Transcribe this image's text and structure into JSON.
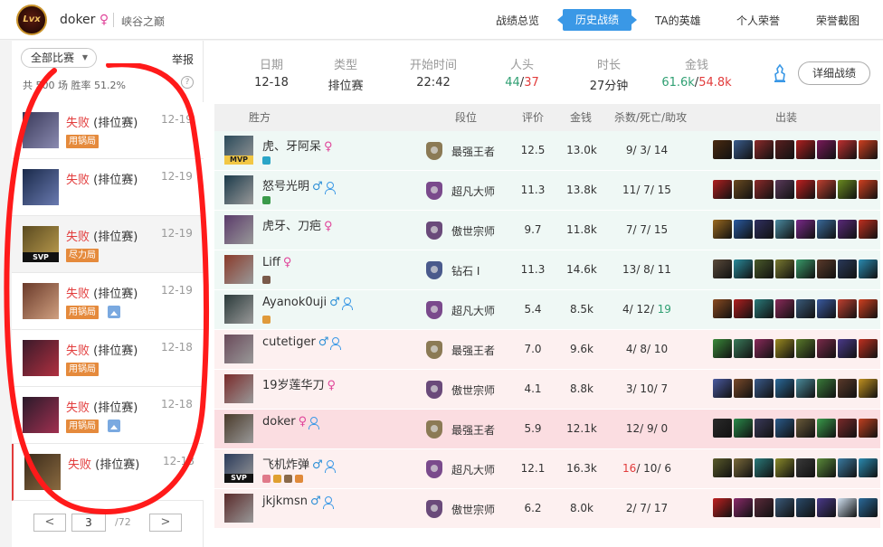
{
  "header": {
    "logo_text": "Lvx",
    "username": "doker",
    "gender_symbol": "♀",
    "server": "峡谷之巅",
    "nav": [
      "战绩总览",
      "历史战绩",
      "TA的英雄",
      "个人荣誉",
      "荣誉截图"
    ],
    "active_nav": "历史战绩"
  },
  "sidebar": {
    "filter_label": "全部比赛",
    "report_label": "举报",
    "stat_text": "共 500 场  胜率 51.2%",
    "help_label": "?",
    "matches": [
      {
        "result": "失败",
        "mode": "(排位赛)",
        "date": "12-19",
        "tag": "用锅局",
        "has_pic": false,
        "badge": ""
      },
      {
        "result": "失败",
        "mode": "(排位赛)",
        "date": "12-19",
        "tag": "",
        "has_pic": false,
        "badge": ""
      },
      {
        "result": "失败",
        "mode": "(排位赛)",
        "date": "12-19",
        "tag": "尽力局",
        "has_pic": false,
        "badge": "SVP"
      },
      {
        "result": "失败",
        "mode": "(排位赛)",
        "date": "12-19",
        "tag": "用锅局",
        "has_pic": true,
        "badge": ""
      },
      {
        "result": "失败",
        "mode": "(排位赛)",
        "date": "12-18",
        "tag": "用锅局",
        "has_pic": false,
        "badge": ""
      },
      {
        "result": "失败",
        "mode": "(排位赛)",
        "date": "12-18",
        "tag": "用锅局",
        "has_pic": true,
        "badge": ""
      },
      {
        "result": "失败",
        "mode": "(排位赛)",
        "date": "12-18",
        "tag": "",
        "has_pic": false,
        "badge": ""
      }
    ],
    "pager": {
      "prev": "<",
      "page": "3",
      "total": "/72",
      "next": ">"
    }
  },
  "summary": {
    "date_label": "日期",
    "date": "12-18",
    "type_label": "类型",
    "type": "排位赛",
    "start_label": "开始时间",
    "start": "22:42",
    "kills_label": "人头",
    "kills_a": "44",
    "kills_sep": "/",
    "kills_b": "37",
    "duration_label": "时长",
    "duration": "27分钟",
    "gold_label": "金钱",
    "gold_a": "61.6k",
    "gold_sep": "/",
    "gold_b": "54.8k",
    "detail_button": "详细战绩"
  },
  "table": {
    "headers": {
      "team": "胜方",
      "rank": "段位",
      "score": "评价",
      "gold": "金钱",
      "kda": "杀数/死亡/助攻",
      "items": "出装"
    },
    "rows": [
      {
        "side": "win",
        "name": "虎、牙阿呆",
        "gender": "♀",
        "friend": false,
        "badge": "MVP",
        "rank": "最强王者",
        "rank_color": "#8b7a55",
        "score": "12.5",
        "score_hl": true,
        "gold": "13.0k",
        "gold_hl": false,
        "k": "9",
        "d": "3",
        "a": "14",
        "k_hl": false,
        "a_hl": false,
        "marks": [
          "#2aa5c7"
        ],
        "items": [
          "#4a2a10",
          "#3a5c8c",
          "#8c2a2a",
          "#5a1f1f",
          "#b02020",
          "#7a1a5a",
          "#c03030",
          "#d04020"
        ]
      },
      {
        "side": "win",
        "name": "怒号光明",
        "gender": "♂",
        "friend": true,
        "badge": "",
        "rank": "超凡大师",
        "rank_color": "#7a4a8c",
        "score": "11.3",
        "score_hl": false,
        "gold": "13.8k",
        "gold_hl": false,
        "k": "11",
        "d": "7",
        "a": "15",
        "k_hl": false,
        "a_hl": false,
        "marks": [
          "#3a9a4a"
        ],
        "items": [
          "#b02020",
          "#6a4a20",
          "#8c2a2a",
          "#5a3a5a",
          "#c02020",
          "#c04030",
          "#6a8a20",
          "#d04020"
        ]
      },
      {
        "side": "win",
        "name": "虎牙、刀疤",
        "gender": "♀",
        "friend": false,
        "badge": "",
        "rank": "傲世宗师",
        "rank_color": "#6a4a7a",
        "score": "9.7",
        "score_hl": false,
        "gold": "11.8k",
        "gold_hl": false,
        "k": "7",
        "d": "7",
        "a": "15",
        "k_hl": false,
        "a_hl": false,
        "marks": [],
        "items": [
          "#9a6a20",
          "#2a5aa0",
          "#303060",
          "#4a8aa0",
          "#7a2a8a",
          "#3a6a9a",
          "#5a2a7a",
          "#c03020"
        ]
      },
      {
        "side": "win",
        "name": "Liff",
        "gender": "♀",
        "friend": false,
        "badge": "",
        "rank": "钻石 Ⅰ",
        "rank_color": "#4a5a8c",
        "score": "11.3",
        "score_hl": false,
        "gold": "14.6k",
        "gold_hl": false,
        "k": "13",
        "d": "8",
        "a": "11",
        "k_hl": false,
        "a_hl": false,
        "marks": [
          "#7a5a4a"
        ],
        "items": [
          "#5a4a3a",
          "#2a8a9a",
          "#4a5a2a",
          "#7a7a30",
          "#3a9a6a",
          "#5a3a2a",
          "#2a3a5a",
          "#2a8ab0"
        ]
      },
      {
        "side": "win",
        "name": "Ayanok0uji",
        "gender": "♂",
        "friend": true,
        "badge": "",
        "rank": "超凡大师",
        "rank_color": "#7a4a8c",
        "score": "5.4",
        "score_hl": false,
        "gold": "8.5k",
        "gold_hl": false,
        "k": "4",
        "d": "12",
        "a": "19",
        "k_hl": false,
        "a_hl": true,
        "marks": [
          "#e09a3a"
        ],
        "items": [
          "#8a4a20",
          "#b02020",
          "#2a7a7a",
          "#8a2a5a",
          "#3a5a7a",
          "#3a5aa0",
          "#c04030",
          "#d04020"
        ]
      },
      {
        "side": "lose",
        "name": "cutetiger",
        "gender": "♂",
        "friend": true,
        "badge": "",
        "rank": "最强王者",
        "rank_color": "#8b7a55",
        "score": "7.0",
        "score_hl": false,
        "gold": "9.6k",
        "gold_hl": false,
        "k": "4",
        "d": "8",
        "a": "10",
        "k_hl": false,
        "a_hl": false,
        "marks": [],
        "items": [
          "#3a8a3a",
          "#3a7a5a",
          "#8a2a5a",
          "#9a8a20",
          "#5a7a2a",
          "#7a2a4a",
          "#4a3a8a",
          "#c03020"
        ]
      },
      {
        "side": "lose",
        "name": "19岁莲华刀",
        "gender": "♀",
        "friend": false,
        "badge": "",
        "rank": "傲世宗师",
        "rank_color": "#6a4a7a",
        "score": "4.1",
        "score_hl": false,
        "gold": "8.8k",
        "gold_hl": false,
        "k": "3",
        "d": "10",
        "a": "7",
        "k_hl": false,
        "a_hl": false,
        "marks": [],
        "items": [
          "#4a5aa0",
          "#7a4a2a",
          "#3a5a8a",
          "#2a6a9a",
          "#4a8a9a",
          "#3a7a3a",
          "#5a3a2a",
          "#c09020"
        ]
      },
      {
        "side": "me",
        "name": "doker",
        "gender": "♀",
        "friend": true,
        "badge": "",
        "rank": "最强王者",
        "rank_color": "#8b7a55",
        "score": "5.9",
        "score_hl": false,
        "gold": "12.1k",
        "gold_hl": false,
        "k": "12",
        "d": "9",
        "a": "0",
        "k_hl": false,
        "a_hl": false,
        "marks": [],
        "items": [
          "#2a2a2a",
          "#2a8a4a",
          "#3a3a5a",
          "#2a5a8a",
          "#6a5a3a",
          "#3a9a4a",
          "#7a2a2a",
          "#c04020"
        ]
      },
      {
        "side": "lose",
        "name": "飞机炸弹",
        "gender": "♂",
        "friend": true,
        "badge": "SVP",
        "rank": "超凡大师",
        "rank_color": "#7a4a8c",
        "score": "12.1",
        "score_hl": false,
        "gold": "16.3k",
        "gold_hl": true,
        "k": "16",
        "d": "10",
        "a": "6",
        "k_hl": true,
        "a_hl": false,
        "marks": [
          "#e07a8a",
          "#e0a030",
          "#8a6a4a",
          "#e08a3a"
        ],
        "items": [
          "#5a5a2a",
          "#7a6a3a",
          "#2a7a7a",
          "#8a8a2a",
          "#3a3a3a",
          "#5a8a3a",
          "#3a7aa0",
          "#2a8ab0"
        ]
      },
      {
        "side": "lose",
        "name": "jkjkmsn",
        "gender": "♂",
        "friend": true,
        "badge": "",
        "rank": "傲世宗师",
        "rank_color": "#6a4a7a",
        "score": "6.2",
        "score_hl": false,
        "gold": "8.0k",
        "gold_hl": false,
        "k": "2",
        "d": "7",
        "a": "17",
        "k_hl": false,
        "a_hl": false,
        "marks": [],
        "items": [
          "#c02020",
          "#8a2a6a",
          "#5a2a3a",
          "#3a5a7a",
          "#2a4a6a",
          "#4a3a8a",
          "#d0e0f0",
          "#2a6a9a"
        ]
      }
    ]
  },
  "colors": {
    "accent": "#3a98e6",
    "loss": "#e23c3c",
    "win": "#2f9f72",
    "tag": "#e58a3c",
    "annotation": "#ff1a1a"
  },
  "icons": {
    "hero_icon": "champion-statue-icon",
    "picture_icon": "image-icon",
    "friend_icon": "friend-add-icon"
  }
}
